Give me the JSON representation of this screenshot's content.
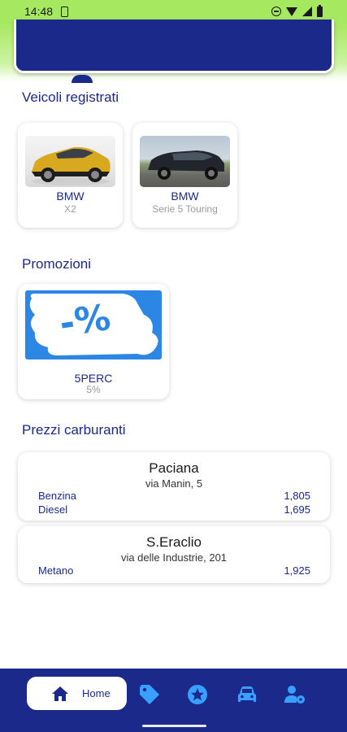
{
  "status_bar": {
    "time": "14:48"
  },
  "sections": {
    "vehicles_title": "Veicoli registrati",
    "promotions_title": "Promozioni",
    "fuel_title": "Prezzi carburanti"
  },
  "vehicles": [
    {
      "brand": "BMW",
      "model": "X2"
    },
    {
      "brand": "BMW",
      "model": "Serie 5 Touring"
    }
  ],
  "promotions": [
    {
      "code": "5PERC",
      "value": "5%",
      "image_text": "-%"
    }
  ],
  "stations": [
    {
      "name": "Paciana",
      "address": "via Manin, 5",
      "fuels": [
        {
          "type": "Benzina",
          "price": "1,805"
        },
        {
          "type": "Diesel",
          "price": "1,695"
        }
      ]
    },
    {
      "name": "S.Eraclio",
      "address": "via delle Industrie, 201",
      "fuels": [
        {
          "type": "Metano",
          "price": "1,925"
        }
      ]
    }
  ],
  "bottom_nav": {
    "items": [
      {
        "label": "Home",
        "icon": "home-icon",
        "active": true
      },
      {
        "icon": "tag-icon"
      },
      {
        "icon": "star-icon"
      },
      {
        "icon": "car-icon"
      },
      {
        "icon": "user-settings-icon"
      }
    ]
  },
  "colors": {
    "primary": "#1b2a8a",
    "accent": "#a6e85f",
    "promo_blue": "#2c86e4",
    "icon_blue": "#3aa0ff"
  }
}
